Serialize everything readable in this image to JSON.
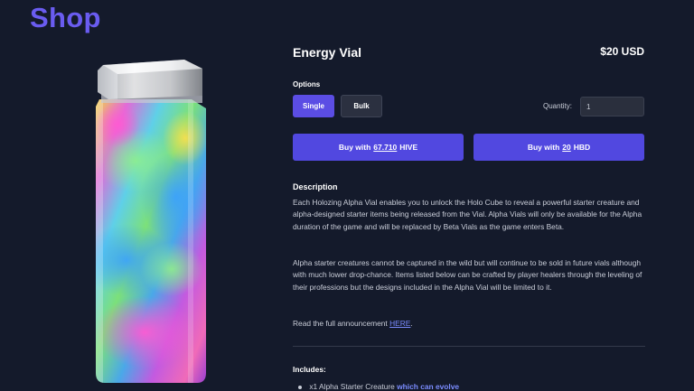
{
  "page": {
    "title": "Shop"
  },
  "product": {
    "name": "Energy Vial",
    "price": "$20 USD",
    "image_alt": "holographic-vial"
  },
  "options": {
    "label": "Options",
    "choices": [
      "Single",
      "Bulk"
    ],
    "selected": "Single"
  },
  "quantity": {
    "label": "Quantity:",
    "value": "1"
  },
  "buy_hive": {
    "prefix": "Buy with",
    "amount": "67.710",
    "currency": "HIVE"
  },
  "buy_hbd": {
    "prefix": "Buy with",
    "amount": "20",
    "currency": "HBD"
  },
  "description": {
    "heading": "Description",
    "paragraph1": "Each Holozing Alpha Vial enables you to unlock the Holo Cube to reveal a powerful starter creature and alpha-designed starter items being released from the Vial. Alpha Vials will only be available for the Alpha duration of the game and will be replaced by Beta Vials as the game enters Beta.",
    "paragraph2": "Alpha starter creatures cannot be captured in the wild but will continue to be sold in future vials although with much lower drop-chance. Items listed below can be crafted by player healers through the leveling of their professions but the designs included in the Alpha Vial will be limited to it.",
    "paragraph3_prefix": "Read the full announcement",
    "paragraph3_link": "HERE",
    "paragraph3_suffix": "."
  },
  "includes": {
    "heading": "Includes:",
    "items": [
      {
        "text": "x1 Alpha Starter Creature",
        "highlight": "which can evolve"
      }
    ]
  },
  "colors": {
    "background": "#141a2b",
    "accent": "#5148e0",
    "title": "#6a5cf0",
    "link": "#7b8cff"
  }
}
